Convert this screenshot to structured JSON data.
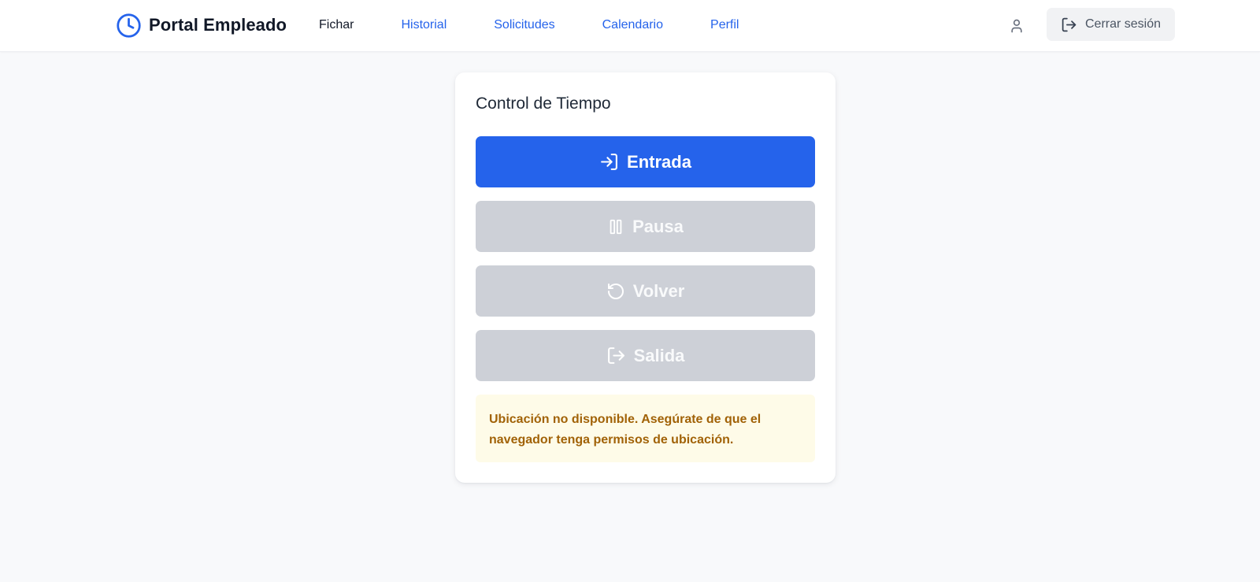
{
  "header": {
    "brand_title": "Portal Empleado",
    "brand_icon": "clock-icon",
    "nav": [
      {
        "label": "Fichar",
        "active": true
      },
      {
        "label": "Historial",
        "active": false
      },
      {
        "label": "Solicitudes",
        "active": false
      },
      {
        "label": "Calendario",
        "active": false
      },
      {
        "label": "Perfil",
        "active": false
      }
    ],
    "user_icon": "user-icon",
    "logout_label": "Cerrar sesión",
    "logout_icon": "log-out-icon"
  },
  "card": {
    "title": "Control de Tiempo",
    "actions": [
      {
        "label": "Entrada",
        "icon": "log-in-icon",
        "enabled": true
      },
      {
        "label": "Pausa",
        "icon": "pause-icon",
        "enabled": false
      },
      {
        "label": "Volver",
        "icon": "rotate-ccw-icon",
        "enabled": false
      },
      {
        "label": "Salida",
        "icon": "log-out-icon",
        "enabled": false
      }
    ],
    "alert_text": "Ubicación no disponible. Asegúrate de que el navegador tenga permisos de ubicación."
  },
  "colors": {
    "primary": "#2563eb",
    "disabled": "#cdd0d7",
    "alert_bg": "#fefbe8",
    "alert_text": "#a16207",
    "page_bg": "#f8f9fb"
  }
}
